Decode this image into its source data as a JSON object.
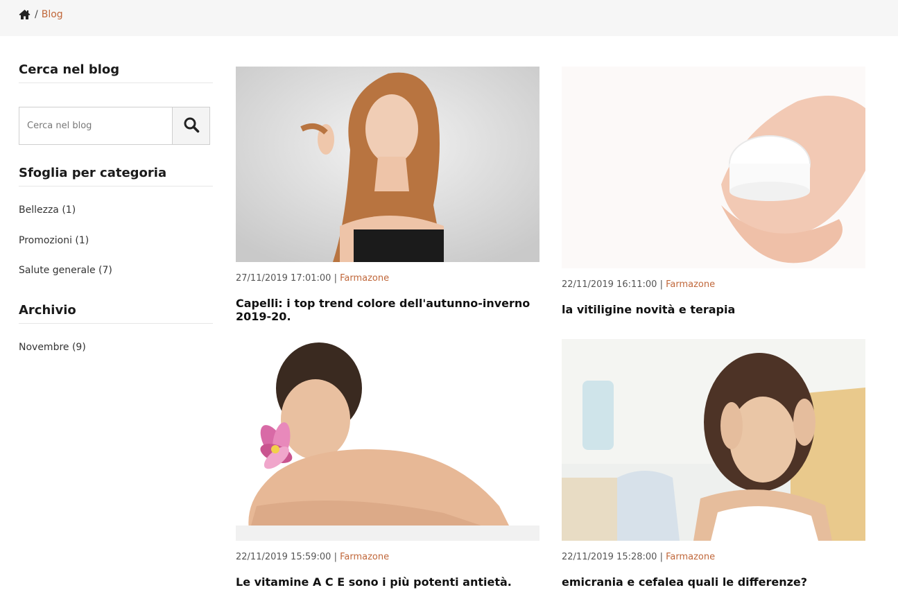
{
  "breadcrumb": {
    "current": "Blog",
    "separator": "/"
  },
  "search": {
    "title": "Cerca nel blog",
    "placeholder": "Cerca nel blog"
  },
  "categories": {
    "title": "Sfoglia per categoria",
    "items": [
      "Bellezza (1)",
      "Promozioni (1)",
      "Salute generale (7)"
    ]
  },
  "archive": {
    "title": "Archivio",
    "items": [
      "Novembre (9)"
    ]
  },
  "posts": [
    {
      "date": "27/11/2019 17:01:00",
      "author": "Farmazone",
      "title": "Capelli: i top trend colore dell'autunno-inverno 2019-20."
    },
    {
      "date": "22/11/2019 16:11:00",
      "author": "Farmazone",
      "title": "la vitiligine novità e terapia"
    },
    {
      "date": "22/11/2019 15:59:00",
      "author": "Farmazone",
      "title": "Le vitamine A C E sono i più potenti antietà."
    },
    {
      "date": "22/11/2019 15:28:00",
      "author": "Farmazone",
      "title": "emicrania e cefalea quali le differenze?"
    }
  ],
  "colors": {
    "accent": "#c0673a",
    "breadcrumb_bg": "#f6f6f6"
  }
}
